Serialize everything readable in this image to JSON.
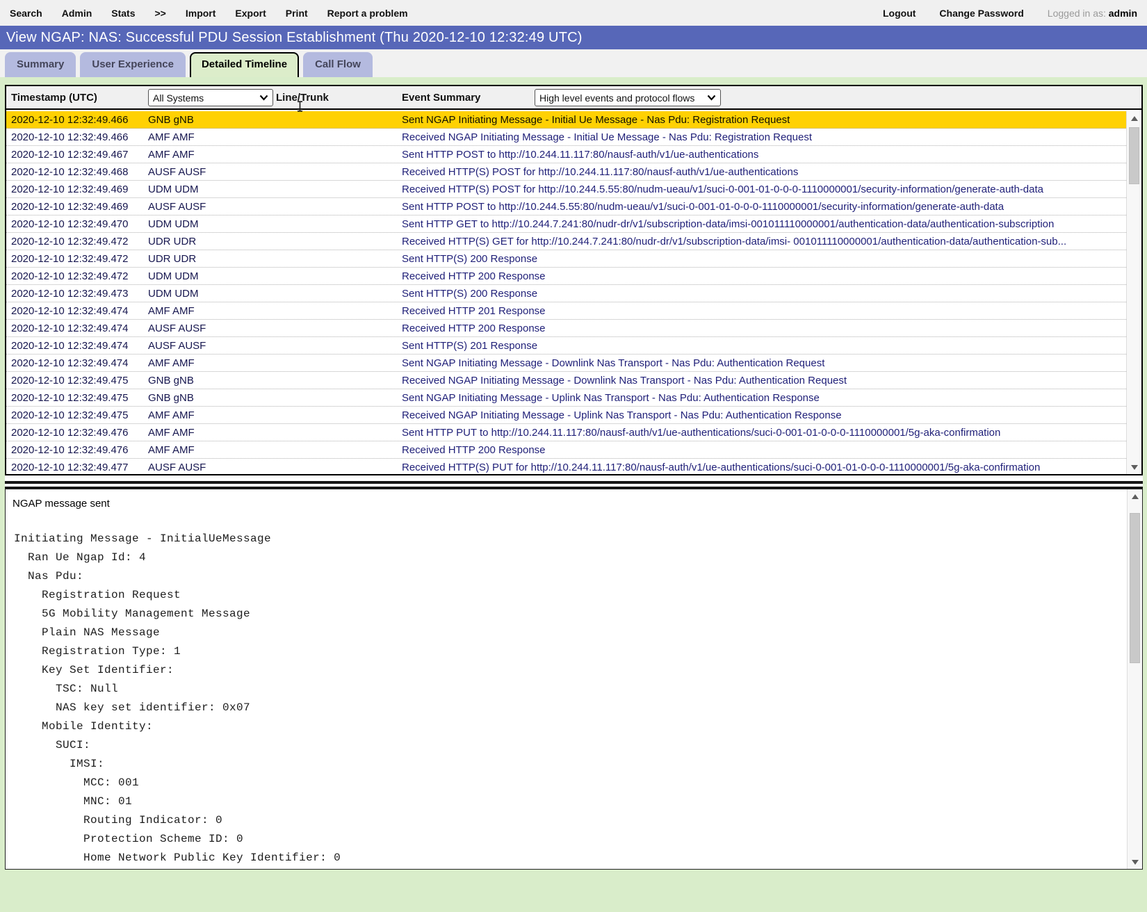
{
  "menu": {
    "items": [
      "Search",
      "Admin",
      "Stats",
      ">>",
      "Import",
      "Export",
      "Print",
      "Report a problem"
    ],
    "logout": "Logout",
    "change_password": "Change Password",
    "logged_in_label": "Logged in as:",
    "username": "admin"
  },
  "title_bar": {
    "title": "View NGAP: NAS: Successful PDU Session Establishment (Thu 2020-12-10 12:32:49 UTC)"
  },
  "tabs": [
    {
      "label": "Summary",
      "active": false
    },
    {
      "label": "User Experience",
      "active": false
    },
    {
      "label": "Detailed Timeline",
      "active": true
    },
    {
      "label": "Call Flow",
      "active": false
    }
  ],
  "timeline": {
    "columns": {
      "timestamp": "Timestamp (UTC)",
      "line_trunk": "Line/Trunk",
      "event": "Event Summary"
    },
    "system_filter": "All Systems",
    "event_filter": "High level events and protocol flows",
    "rows": [
      {
        "timestamp": "2020-12-10 12:32:49.466",
        "system": "GNB gNB",
        "event": "Sent NGAP Initiating Message - Initial Ue Message - Nas Pdu: Registration Request",
        "selected": true
      },
      {
        "timestamp": "2020-12-10 12:32:49.466",
        "system": "AMF AMF",
        "event": "Received NGAP Initiating Message - Initial Ue Message - Nas Pdu: Registration Request",
        "selected": false
      },
      {
        "timestamp": "2020-12-10 12:32:49.467",
        "system": "AMF AMF",
        "event": "Sent HTTP POST to http://10.244.11.117:80/nausf-auth/v1/ue-authentications",
        "selected": false
      },
      {
        "timestamp": "2020-12-10 12:32:49.468",
        "system": "AUSF AUSF",
        "event": "Received HTTP(S) POST for http://10.244.11.117:80/nausf-auth/v1/ue-authentications",
        "selected": false
      },
      {
        "timestamp": "2020-12-10 12:32:49.469",
        "system": "UDM UDM",
        "event": "Received HTTP(S) POST for http://10.244.5.55:80/nudm-ueau/v1/suci-0-001-01-0-0-0-1110000001/security-information/generate-auth-data",
        "selected": false
      },
      {
        "timestamp": "2020-12-10 12:32:49.469",
        "system": "AUSF AUSF",
        "event": "Sent HTTP POST to http://10.244.5.55:80/nudm-ueau/v1/suci-0-001-01-0-0-0-1110000001/security-information/generate-auth-data",
        "selected": false
      },
      {
        "timestamp": "2020-12-10 12:32:49.470",
        "system": "UDM UDM",
        "event": "Sent HTTP GET to http://10.244.7.241:80/nudr-dr/v1/subscription-data/imsi-001011110000001/authentication-data/authentication-subscription",
        "selected": false
      },
      {
        "timestamp": "2020-12-10 12:32:49.472",
        "system": "UDR UDR",
        "event": "Received HTTP(S) GET for http://10.244.7.241:80/nudr-dr/v1/subscription-data/imsi- 001011110000001/authentication-data/authentication-sub...",
        "selected": false
      },
      {
        "timestamp": "2020-12-10 12:32:49.472",
        "system": "UDR UDR",
        "event": "Sent HTTP(S) 200 Response",
        "selected": false
      },
      {
        "timestamp": "2020-12-10 12:32:49.472",
        "system": "UDM UDM",
        "event": "Received HTTP 200 Response",
        "selected": false
      },
      {
        "timestamp": "2020-12-10 12:32:49.473",
        "system": "UDM UDM",
        "event": "Sent HTTP(S) 200 Response",
        "selected": false
      },
      {
        "timestamp": "2020-12-10 12:32:49.474",
        "system": "AMF AMF",
        "event": "Received HTTP 201 Response",
        "selected": false
      },
      {
        "timestamp": "2020-12-10 12:32:49.474",
        "system": "AUSF AUSF",
        "event": "Received HTTP 200 Response",
        "selected": false
      },
      {
        "timestamp": "2020-12-10 12:32:49.474",
        "system": "AUSF AUSF",
        "event": "Sent HTTP(S) 201 Response",
        "selected": false
      },
      {
        "timestamp": "2020-12-10 12:32:49.474",
        "system": "AMF AMF",
        "event": "Sent NGAP Initiating Message - Downlink Nas Transport - Nas Pdu: Authentication Request",
        "selected": false
      },
      {
        "timestamp": "2020-12-10 12:32:49.475",
        "system": "GNB gNB",
        "event": "Received NGAP Initiating Message - Downlink Nas Transport - Nas Pdu: Authentication Request",
        "selected": false
      },
      {
        "timestamp": "2020-12-10 12:32:49.475",
        "system": "GNB gNB",
        "event": "Sent NGAP Initiating Message - Uplink Nas Transport - Nas Pdu: Authentication Response",
        "selected": false
      },
      {
        "timestamp": "2020-12-10 12:32:49.475",
        "system": "AMF AMF",
        "event": "Received NGAP Initiating Message - Uplink Nas Transport - Nas Pdu: Authentication Response",
        "selected": false
      },
      {
        "timestamp": "2020-12-10 12:32:49.476",
        "system": "AMF AMF",
        "event": "Sent HTTP PUT to http://10.244.11.117:80/nausf-auth/v1/ue-authentications/suci-0-001-01-0-0-0-1110000001/5g-aka-confirmation",
        "selected": false
      },
      {
        "timestamp": "2020-12-10 12:32:49.476",
        "system": "AMF AMF",
        "event": "Received HTTP 200 Response",
        "selected": false
      },
      {
        "timestamp": "2020-12-10 12:32:49.477",
        "system": "AUSF AUSF",
        "event": "Received HTTP(S) PUT for http://10.244.11.117:80/nausf-auth/v1/ue-authentications/suci-0-001-01-0-0-0-1110000001/5g-aka-confirmation",
        "selected": false
      }
    ]
  },
  "detail": {
    "title": "NGAP message sent",
    "lines": [
      "Initiating Message - InitialUeMessage",
      "  Ran Ue Ngap Id: 4",
      "  Nas Pdu:",
      "    Registration Request",
      "    5G Mobility Management Message",
      "    Plain NAS Message",
      "    Registration Type: 1",
      "    Key Set Identifier:",
      "      TSC: Null",
      "      NAS key set identifier: 0x07",
      "    Mobile Identity:",
      "      SUCI:",
      "        IMSI:",
      "          MCC: 001",
      "          MNC: 01",
      "          Routing Indicator: 0",
      "          Protection Scheme ID: 0",
      "          Home Network Public Key Identifier: 0"
    ]
  },
  "colors": {
    "title_bar": "#5767b8",
    "inactive_tab": "#b4badf",
    "active_tab": "#dcedca",
    "page_background": "#d9edca",
    "selected_row": "#ffd103",
    "event_text": "#1f1f78",
    "menu_bar": "#f0f0f0"
  }
}
